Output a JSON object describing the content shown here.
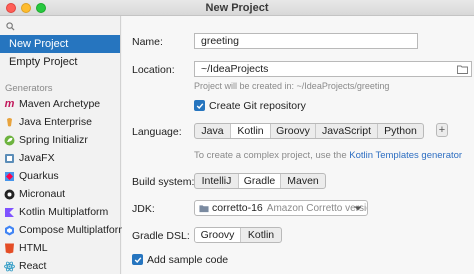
{
  "window": {
    "title": "New Project"
  },
  "sidebar": {
    "search_placeholder": "",
    "items": [
      {
        "label": "New Project",
        "selected": true
      },
      {
        "label": "Empty Project",
        "selected": false
      }
    ],
    "generators_label": "Generators",
    "generators": [
      {
        "label": "Maven Archetype",
        "icon": "maven-icon",
        "color": "#c2185b",
        "glyph": "m"
      },
      {
        "label": "Java Enterprise",
        "icon": "java-enterprise-icon",
        "color": "#e8a33d",
        "glyph": ""
      },
      {
        "label": "Spring Initializr",
        "icon": "spring-icon",
        "color": "#6db33f",
        "glyph": ""
      },
      {
        "label": "JavaFX",
        "icon": "javafx-icon",
        "color": "#5b8db8",
        "glyph": ""
      },
      {
        "label": "Quarkus",
        "icon": "quarkus-icon",
        "color": "#4695eb",
        "glyph": ""
      },
      {
        "label": "Micronaut",
        "icon": "micronaut-icon",
        "color": "#222222",
        "glyph": ""
      },
      {
        "label": "Kotlin Multiplatform",
        "icon": "kotlin-icon",
        "color": "#7f52ff",
        "glyph": ""
      },
      {
        "label": "Compose Multiplatform",
        "icon": "compose-icon",
        "color": "#4285f4",
        "glyph": ""
      },
      {
        "label": "HTML",
        "icon": "html-icon",
        "color": "#e44d26",
        "glyph": ""
      },
      {
        "label": "React",
        "icon": "react-icon",
        "color": "#61dafb",
        "glyph": ""
      }
    ]
  },
  "form": {
    "name_label": "Name:",
    "name_value": "greeting",
    "location_label": "Location:",
    "location_value": "~/IdeaProjects",
    "location_hint": "Project will be created in: ~/IdeaProjects/greeting",
    "git_label": "Create Git repository",
    "git_checked": true,
    "language_label": "Language:",
    "languages": [
      "Java",
      "Kotlin",
      "Groovy",
      "JavaScript",
      "Python"
    ],
    "language_selected": "Kotlin",
    "add_language": "+",
    "complex_prefix": "To create a complex project, use the ",
    "complex_link": "Kotlin Templates generator",
    "build_label": "Build system:",
    "builds": [
      "IntelliJ",
      "Gradle",
      "Maven"
    ],
    "build_selected": "Gradle",
    "jdk_label": "JDK:",
    "jdk_value": "corretto-16",
    "jdk_detail": "Amazon Corretto versio",
    "dsl_label": "Gradle DSL:",
    "dsls": [
      "Groovy",
      "Kotlin"
    ],
    "dsl_selected": "Groovy",
    "sample_label": "Add sample code",
    "sample_checked": true
  },
  "colors": {
    "accent": "#2675bf",
    "link": "#2e6fc2",
    "hint": "#8a8a8a"
  }
}
